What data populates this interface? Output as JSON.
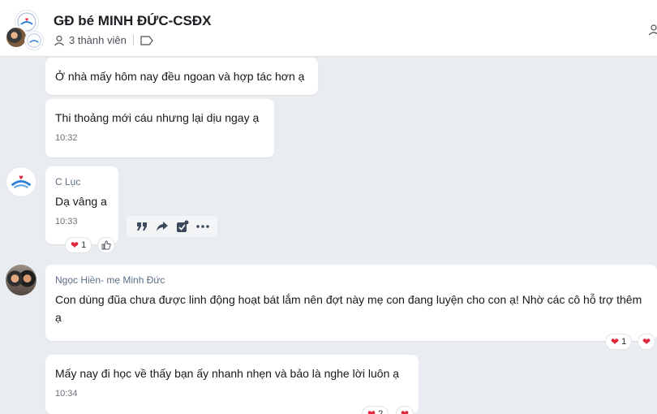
{
  "header": {
    "title": "GĐ bé MINH ĐỨC-CSĐX",
    "member_count": "3 thành viên"
  },
  "colors": {
    "heart": "#e0263c",
    "bubble": "#ffffff",
    "background": "#e9ecf0"
  },
  "messages": [
    {
      "text": "Ở nhà mấy hôm nay đều ngoan và hợp tác hơn ạ"
    },
    {
      "text": "Thi thoảng mới cáu nhưng lại dịu ngay ạ",
      "time": "10:32"
    },
    {
      "sender": "C Lục",
      "text": "Dạ vâng a",
      "time": "10:33",
      "reaction_count": "1"
    },
    {
      "sender": "Ngọc Hiền- mẹ Minh Đức",
      "text": "Con dùng đũa chưa được linh động hoạt bát lắm nên đợt này mẹ con đang luyện cho con ạ! Nhờ các cô hỗ trợ thêm ạ",
      "reaction_count": "1"
    },
    {
      "text": "Mấy nay đi học về thấy bạn ấy nhanh nhẹn và bảo là nghe lời luôn ạ",
      "time": "10:34",
      "reaction_count": "2"
    }
  ],
  "icons": {
    "members": "person-icon",
    "tag": "tag-icon",
    "quote": "quote-icon",
    "forward": "forward-icon",
    "task": "task-check-icon",
    "more": "more-icon",
    "like": "thumbs-up-icon",
    "heart": "heart-icon"
  }
}
